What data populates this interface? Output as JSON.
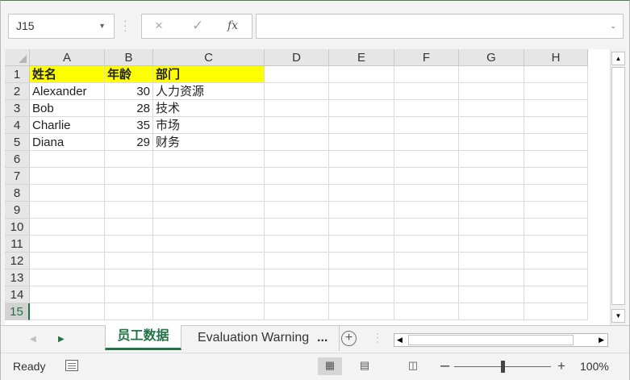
{
  "formula_bar": {
    "name_box": "J15",
    "cancel_icon": "×",
    "enter_icon": "✓",
    "fx_label": "fx",
    "formula": ""
  },
  "sheet": {
    "columns": [
      "A",
      "B",
      "C",
      "D",
      "E",
      "F",
      "G",
      "H"
    ],
    "rows": [
      "1",
      "2",
      "3",
      "4",
      "5",
      "6",
      "7",
      "8",
      "9",
      "10",
      "11",
      "12",
      "13",
      "14",
      "15"
    ],
    "selected_row": "15",
    "header_fill": "#ffff00",
    "cells": {
      "A1": "姓名",
      "B1": "年龄",
      "C1": "部门",
      "A2": "Alexander",
      "B2": "30",
      "C2": "人力资源",
      "A3": "Bob",
      "B3": "28",
      "C3": "技术",
      "A4": "Charlie",
      "B4": "35",
      "C4": "市场",
      "A5": "Diana",
      "B5": "29",
      "C5": "财务"
    }
  },
  "tabs": {
    "active": "员工数据",
    "second": "Evaluation Warning",
    "ellipsis": "...",
    "add_icon": "+"
  },
  "status": {
    "ready": "Ready",
    "zoom": "100%",
    "zoom_minus": "–",
    "zoom_plus": "+",
    "zoom_level": 0.5
  },
  "colors": {
    "accent": "#217346"
  }
}
